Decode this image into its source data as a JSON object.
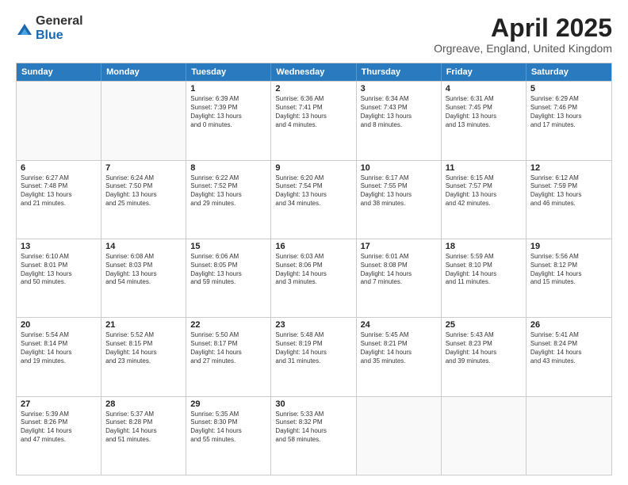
{
  "logo": {
    "general": "General",
    "blue": "Blue"
  },
  "title": "April 2025",
  "location": "Orgreave, England, United Kingdom",
  "days": [
    "Sunday",
    "Monday",
    "Tuesday",
    "Wednesday",
    "Thursday",
    "Friday",
    "Saturday"
  ],
  "rows": [
    [
      {
        "day": "",
        "empty": true
      },
      {
        "day": "",
        "empty": true
      },
      {
        "day": "1",
        "line1": "Sunrise: 6:39 AM",
        "line2": "Sunset: 7:39 PM",
        "line3": "Daylight: 13 hours",
        "line4": "and 0 minutes."
      },
      {
        "day": "2",
        "line1": "Sunrise: 6:36 AM",
        "line2": "Sunset: 7:41 PM",
        "line3": "Daylight: 13 hours",
        "line4": "and 4 minutes."
      },
      {
        "day": "3",
        "line1": "Sunrise: 6:34 AM",
        "line2": "Sunset: 7:43 PM",
        "line3": "Daylight: 13 hours",
        "line4": "and 8 minutes."
      },
      {
        "day": "4",
        "line1": "Sunrise: 6:31 AM",
        "line2": "Sunset: 7:45 PM",
        "line3": "Daylight: 13 hours",
        "line4": "and 13 minutes."
      },
      {
        "day": "5",
        "line1": "Sunrise: 6:29 AM",
        "line2": "Sunset: 7:46 PM",
        "line3": "Daylight: 13 hours",
        "line4": "and 17 minutes."
      }
    ],
    [
      {
        "day": "6",
        "line1": "Sunrise: 6:27 AM",
        "line2": "Sunset: 7:48 PM",
        "line3": "Daylight: 13 hours",
        "line4": "and 21 minutes."
      },
      {
        "day": "7",
        "line1": "Sunrise: 6:24 AM",
        "line2": "Sunset: 7:50 PM",
        "line3": "Daylight: 13 hours",
        "line4": "and 25 minutes."
      },
      {
        "day": "8",
        "line1": "Sunrise: 6:22 AM",
        "line2": "Sunset: 7:52 PM",
        "line3": "Daylight: 13 hours",
        "line4": "and 29 minutes."
      },
      {
        "day": "9",
        "line1": "Sunrise: 6:20 AM",
        "line2": "Sunset: 7:54 PM",
        "line3": "Daylight: 13 hours",
        "line4": "and 34 minutes."
      },
      {
        "day": "10",
        "line1": "Sunrise: 6:17 AM",
        "line2": "Sunset: 7:55 PM",
        "line3": "Daylight: 13 hours",
        "line4": "and 38 minutes."
      },
      {
        "day": "11",
        "line1": "Sunrise: 6:15 AM",
        "line2": "Sunset: 7:57 PM",
        "line3": "Daylight: 13 hours",
        "line4": "and 42 minutes."
      },
      {
        "day": "12",
        "line1": "Sunrise: 6:12 AM",
        "line2": "Sunset: 7:59 PM",
        "line3": "Daylight: 13 hours",
        "line4": "and 46 minutes."
      }
    ],
    [
      {
        "day": "13",
        "line1": "Sunrise: 6:10 AM",
        "line2": "Sunset: 8:01 PM",
        "line3": "Daylight: 13 hours",
        "line4": "and 50 minutes."
      },
      {
        "day": "14",
        "line1": "Sunrise: 6:08 AM",
        "line2": "Sunset: 8:03 PM",
        "line3": "Daylight: 13 hours",
        "line4": "and 54 minutes."
      },
      {
        "day": "15",
        "line1": "Sunrise: 6:06 AM",
        "line2": "Sunset: 8:05 PM",
        "line3": "Daylight: 13 hours",
        "line4": "and 59 minutes."
      },
      {
        "day": "16",
        "line1": "Sunrise: 6:03 AM",
        "line2": "Sunset: 8:06 PM",
        "line3": "Daylight: 14 hours",
        "line4": "and 3 minutes."
      },
      {
        "day": "17",
        "line1": "Sunrise: 6:01 AM",
        "line2": "Sunset: 8:08 PM",
        "line3": "Daylight: 14 hours",
        "line4": "and 7 minutes."
      },
      {
        "day": "18",
        "line1": "Sunrise: 5:59 AM",
        "line2": "Sunset: 8:10 PM",
        "line3": "Daylight: 14 hours",
        "line4": "and 11 minutes."
      },
      {
        "day": "19",
        "line1": "Sunrise: 5:56 AM",
        "line2": "Sunset: 8:12 PM",
        "line3": "Daylight: 14 hours",
        "line4": "and 15 minutes."
      }
    ],
    [
      {
        "day": "20",
        "line1": "Sunrise: 5:54 AM",
        "line2": "Sunset: 8:14 PM",
        "line3": "Daylight: 14 hours",
        "line4": "and 19 minutes."
      },
      {
        "day": "21",
        "line1": "Sunrise: 5:52 AM",
        "line2": "Sunset: 8:15 PM",
        "line3": "Daylight: 14 hours",
        "line4": "and 23 minutes."
      },
      {
        "day": "22",
        "line1": "Sunrise: 5:50 AM",
        "line2": "Sunset: 8:17 PM",
        "line3": "Daylight: 14 hours",
        "line4": "and 27 minutes."
      },
      {
        "day": "23",
        "line1": "Sunrise: 5:48 AM",
        "line2": "Sunset: 8:19 PM",
        "line3": "Daylight: 14 hours",
        "line4": "and 31 minutes."
      },
      {
        "day": "24",
        "line1": "Sunrise: 5:45 AM",
        "line2": "Sunset: 8:21 PM",
        "line3": "Daylight: 14 hours",
        "line4": "and 35 minutes."
      },
      {
        "day": "25",
        "line1": "Sunrise: 5:43 AM",
        "line2": "Sunset: 8:23 PM",
        "line3": "Daylight: 14 hours",
        "line4": "and 39 minutes."
      },
      {
        "day": "26",
        "line1": "Sunrise: 5:41 AM",
        "line2": "Sunset: 8:24 PM",
        "line3": "Daylight: 14 hours",
        "line4": "and 43 minutes."
      }
    ],
    [
      {
        "day": "27",
        "line1": "Sunrise: 5:39 AM",
        "line2": "Sunset: 8:26 PM",
        "line3": "Daylight: 14 hours",
        "line4": "and 47 minutes."
      },
      {
        "day": "28",
        "line1": "Sunrise: 5:37 AM",
        "line2": "Sunset: 8:28 PM",
        "line3": "Daylight: 14 hours",
        "line4": "and 51 minutes."
      },
      {
        "day": "29",
        "line1": "Sunrise: 5:35 AM",
        "line2": "Sunset: 8:30 PM",
        "line3": "Daylight: 14 hours",
        "line4": "and 55 minutes."
      },
      {
        "day": "30",
        "line1": "Sunrise: 5:33 AM",
        "line2": "Sunset: 8:32 PM",
        "line3": "Daylight: 14 hours",
        "line4": "and 58 minutes."
      },
      {
        "day": "",
        "empty": true
      },
      {
        "day": "",
        "empty": true
      },
      {
        "day": "",
        "empty": true
      }
    ]
  ]
}
